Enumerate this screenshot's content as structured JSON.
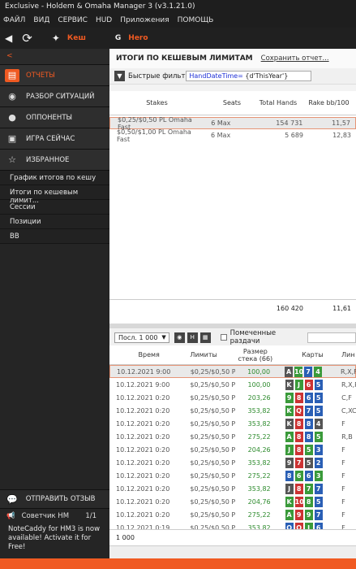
{
  "titlebar": {
    "title": "Exclusive - Holdem & Omaha Manager 3 (v3.1.21.0)"
  },
  "menu": [
    "ФАЙЛ",
    "ВИД",
    "СЕРВИС",
    "HUD",
    "Приложения",
    "ПОМОЩЬ"
  ],
  "toolbar": {
    "cash_label": "Кеш",
    "hero_label": "Hero"
  },
  "sidebar": {
    "back": "<",
    "items": [
      {
        "label": "ОТЧЕТЫ",
        "icon": "report-icon",
        "active": true
      },
      {
        "label": "РАЗБОР СИТУАЦИЙ",
        "icon": "eye-icon"
      },
      {
        "label": "ОППОНЕНТЫ",
        "icon": "user-icon"
      },
      {
        "label": "ИГРА СЕЙЧАС",
        "icon": "play-icon"
      },
      {
        "label": "ИЗБРАННОЕ",
        "icon": "star-icon"
      }
    ],
    "subitems": [
      "График итогов по кешу",
      "Итоги по кешевым лимит...",
      "Сессии",
      "Позиции",
      "BB"
    ],
    "feedback": "ОТПРАВИТЬ ОТЗЫВ",
    "advisor": {
      "label": "Советчик HM",
      "count": "1/1"
    },
    "note": "NoteCaddy for HM3 is now available!  Activate it for Free!"
  },
  "report": {
    "title": "ИТОГИ ПО КЕШЕВЫМ ЛИМИТАМ",
    "save": "Сохранить отчет...",
    "filter_label": "Быстрые фильт",
    "filter_key": "HandDateTime=",
    "filter_val": " {d'ThisYear'}",
    "headers": {
      "stakes": "Stakes",
      "seats": "Seats",
      "total": "Total Hands",
      "rake": "Rake bb/100"
    },
    "rows": [
      {
        "stakes": "$0,25/$0,50 PL Omaha Fast",
        "seats": "6 Max",
        "total": "154 731",
        "rake": "11,57"
      },
      {
        "stakes": "$0,50/$1,00 PL Omaha Fast",
        "seats": "6 Max",
        "total": "5 689",
        "rake": "12,83"
      }
    ],
    "totals": {
      "total": "160 420",
      "rake": "11,61"
    }
  },
  "hands": {
    "last_select": "Посл. 1 000",
    "btn_h": "H",
    "marked_label": "Помеченные раздачи",
    "headers": {
      "time": "Время",
      "limits": "Лимиты",
      "stack": "Размер стека (66)",
      "cards": "Карты",
      "line": "Лин"
    },
    "rows": [
      {
        "time": "10.12.2021 9:00",
        "lim": "$0,25/$0,50 PL C",
        "stack": "100,00",
        "cards": [
          [
            "A",
            "s"
          ],
          [
            "10",
            "c"
          ],
          [
            "7",
            "d"
          ],
          [
            "4",
            "c"
          ]
        ],
        "line": "R,X,F"
      },
      {
        "time": "10.12.2021 9:00",
        "lim": "$0,25/$0,50 PL C",
        "stack": "100,00",
        "cards": [
          [
            "K",
            "s"
          ],
          [
            "J",
            "c"
          ],
          [
            "6",
            "h"
          ],
          [
            "5",
            "d"
          ]
        ],
        "line": "R,X,R"
      },
      {
        "time": "10.12.2021 0:20",
        "lim": "$0,25/$0,50 PL C",
        "stack": "203,26",
        "cards": [
          [
            "9",
            "c"
          ],
          [
            "8",
            "h"
          ],
          [
            "6",
            "d"
          ],
          [
            "5",
            "d"
          ]
        ],
        "line": "C,F"
      },
      {
        "time": "10.12.2021 0:20",
        "lim": "$0,25/$0,50 PL C",
        "stack": "353,82",
        "cards": [
          [
            "K",
            "c"
          ],
          [
            "Q",
            "h"
          ],
          [
            "7",
            "d"
          ],
          [
            "5",
            "d"
          ]
        ],
        "line": "C,XC,X"
      },
      {
        "time": "10.12.2021 0:20",
        "lim": "$0,25/$0,50 PL C",
        "stack": "353,82",
        "cards": [
          [
            "K",
            "s"
          ],
          [
            "8",
            "h"
          ],
          [
            "8",
            "d"
          ],
          [
            "4",
            "s"
          ]
        ],
        "line": "F"
      },
      {
        "time": "10.12.2021 0:20",
        "lim": "$0,25/$0,50 PL C",
        "stack": "275,22",
        "cards": [
          [
            "A",
            "c"
          ],
          [
            "8",
            "h"
          ],
          [
            "8",
            "d"
          ],
          [
            "5",
            "c"
          ]
        ],
        "line": "R,B"
      },
      {
        "time": "10.12.2021 0:20",
        "lim": "$0,25/$0,50 PL C",
        "stack": "204,26",
        "cards": [
          [
            "J",
            "c"
          ],
          [
            "8",
            "h"
          ],
          [
            "5",
            "c"
          ],
          [
            "3",
            "d"
          ]
        ],
        "line": "F"
      },
      {
        "time": "10.12.2021 0:20",
        "lim": "$0,25/$0,50 PL C",
        "stack": "353,82",
        "cards": [
          [
            "9",
            "s"
          ],
          [
            "7",
            "h"
          ],
          [
            "5",
            "s"
          ],
          [
            "2",
            "d"
          ]
        ],
        "line": "F"
      },
      {
        "time": "10.12.2021 0:20",
        "lim": "$0,25/$0,50 PL C",
        "stack": "275,22",
        "cards": [
          [
            "8",
            "d"
          ],
          [
            "6",
            "c"
          ],
          [
            "6",
            "d"
          ],
          [
            "3",
            "c"
          ]
        ],
        "line": "F"
      },
      {
        "time": "10.12.2021 0:20",
        "lim": "$0,25/$0,50 PL C",
        "stack": "353,82",
        "cards": [
          [
            "J",
            "s"
          ],
          [
            "8",
            "h"
          ],
          [
            "7",
            "c"
          ],
          [
            "7",
            "d"
          ]
        ],
        "line": "F"
      },
      {
        "time": "10.12.2021 0:20",
        "lim": "$0,25/$0,50 PL C",
        "stack": "204,76",
        "cards": [
          [
            "K",
            "c"
          ],
          [
            "10",
            "h"
          ],
          [
            "8",
            "c"
          ],
          [
            "5",
            "d"
          ]
        ],
        "line": "F"
      },
      {
        "time": "10.12.2021 0:20",
        "lim": "$0,25/$0,50 PL C",
        "stack": "275,22",
        "cards": [
          [
            "A",
            "c"
          ],
          [
            "9",
            "h"
          ],
          [
            "9",
            "c"
          ],
          [
            "7",
            "d"
          ]
        ],
        "line": "F"
      },
      {
        "time": "10.12.2021 0:19",
        "lim": "$0,25/$0,50 PL C",
        "stack": "353,82",
        "cards": [
          [
            "Q",
            "d"
          ],
          [
            "Q",
            "h"
          ],
          [
            "J",
            "c"
          ],
          [
            "6",
            "d"
          ]
        ],
        "line": "F"
      }
    ],
    "footer": "1 000"
  },
  "colors": {
    "accent": "#f05a22",
    "stack_green": "#2e8b2e"
  }
}
